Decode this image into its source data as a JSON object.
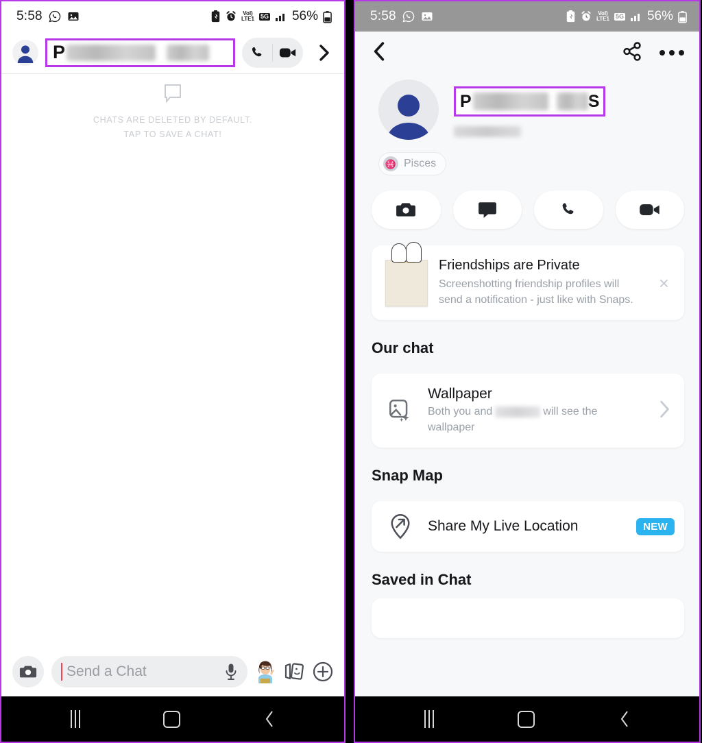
{
  "status_bar": {
    "time": "5:58",
    "left_icons": [
      "whatsapp-icon",
      "photos-icon"
    ],
    "right_icons": [
      "battery-saver-icon",
      "alarm-icon"
    ],
    "volte_top": "VoI)",
    "volte_bottom": "LTE1",
    "network": "5G",
    "battery_percent": "56%"
  },
  "left_screen": {
    "header": {
      "avatar": "default-avatar",
      "name_initial": "P",
      "name_blurred": true,
      "call_icon": "phone-icon",
      "video_icon": "video-camera-icon",
      "forward_icon": "chevron-right-icon"
    },
    "empty_state": {
      "icon": "chat-bubble-icon",
      "line1": "CHATS ARE DELETED BY DEFAULT.",
      "line2": "TAP TO SAVE A CHAT!"
    },
    "chat_bar": {
      "camera_icon": "camera-icon",
      "input_value": "",
      "input_placeholder": "Send a Chat",
      "mic_icon": "microphone-icon",
      "bitmoji_icon": "bitmoji-avatar-icon",
      "stickers_icon": "stickers-icon",
      "plus_icon": "plus-circle-icon"
    }
  },
  "right_screen": {
    "topbar": {
      "back_icon": "chevron-left-icon",
      "share_icon": "share-icon",
      "more_icon": "more-options-icon"
    },
    "profile": {
      "avatar": "default-avatar",
      "name_initial": "P",
      "name_last_initial": "S",
      "name_blurred": true,
      "username_blurred": true,
      "zodiac_label": "Pisces",
      "zodiac_icon": "pisces-icon"
    },
    "actions": [
      {
        "name": "camera-action",
        "icon": "camera-icon"
      },
      {
        "name": "chat-action",
        "icon": "chat-bubble-icon"
      },
      {
        "name": "call-action",
        "icon": "phone-icon"
      },
      {
        "name": "video-action",
        "icon": "video-camera-icon"
      }
    ],
    "promo_card": {
      "image": "polaroid-ghosts-icon",
      "title": "Friendships are Private",
      "subtitle": "Screenshotting friendship profiles will send a notification - just like with Snaps.",
      "close_icon": "close-icon",
      "close_glyph": "×"
    },
    "sections": [
      {
        "title": "Our chat",
        "rows": [
          {
            "name": "wallpaper-row",
            "icon": "image-sparkle-icon",
            "title": "Wallpaper",
            "sub_before": "Both you and",
            "sub_blurred": true,
            "sub_after": "will see the wallpaper",
            "chevron": "chevron-right-icon"
          }
        ]
      },
      {
        "title": "Snap Map",
        "rows": [
          {
            "name": "share-live-location-row",
            "icon": "location-pin-arrow-icon",
            "title": "Share My Live Location",
            "badge": "NEW"
          }
        ]
      },
      {
        "title": "Saved in Chat",
        "rows": []
      }
    ]
  },
  "nav_bar": {
    "recents_icon": "recents-icon",
    "home_icon": "home-icon",
    "back_icon": "back-icon"
  },
  "colors": {
    "highlight": "#b638e8",
    "badge_new": "#2bb3ef",
    "panel_bg": "#f7f8fa",
    "avatar_blue": "#2b3f95",
    "caret_red": "#ff3b4e"
  }
}
